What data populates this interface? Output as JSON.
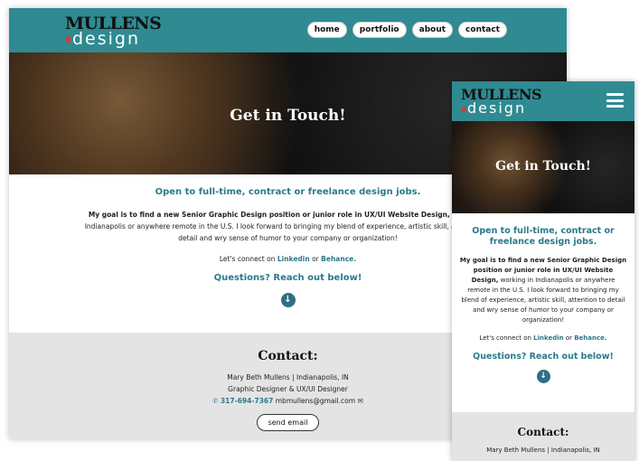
{
  "brand": {
    "line1": "MULLENS",
    "line2": "design"
  },
  "nav": {
    "items": [
      {
        "label": "home"
      },
      {
        "label": "portfolio"
      },
      {
        "label": "about"
      },
      {
        "label": "contact"
      }
    ]
  },
  "hero": {
    "title": "Get in Touch!"
  },
  "intro": {
    "heading": "Open to full-time, contract or freelance design jobs.",
    "goal_bold": "My goal is to find a new Senior Graphic Design position or junior role in UX/UI Website Design,",
    "goal_rest": " working in Indianapolis or anywhere remote in the U.S. I look forward to bringing my blend of experience, artistic skill, attention to detail and wry sense of humor to your company or organization!",
    "connect_prefix": "Let's connect on ",
    "linkedin": "Linkedin",
    "connect_or": " or ",
    "behance": "Behance.",
    "questions": "Questions? Reach out below!",
    "down_arrow_glyph": "↓"
  },
  "contact": {
    "heading": "Contact:",
    "name_line": "Mary Beth Mullens | Indianapolis, IN",
    "title_line": "Graphic Designer & UX/UI Designer",
    "phone": "317-694-7367",
    "email": "mbmullens@gmail.com",
    "send_label": "send email"
  },
  "colors": {
    "teal": "#2f8a91",
    "accent": "#2a7a8a",
    "contact_bg": "#e4e4e4"
  }
}
